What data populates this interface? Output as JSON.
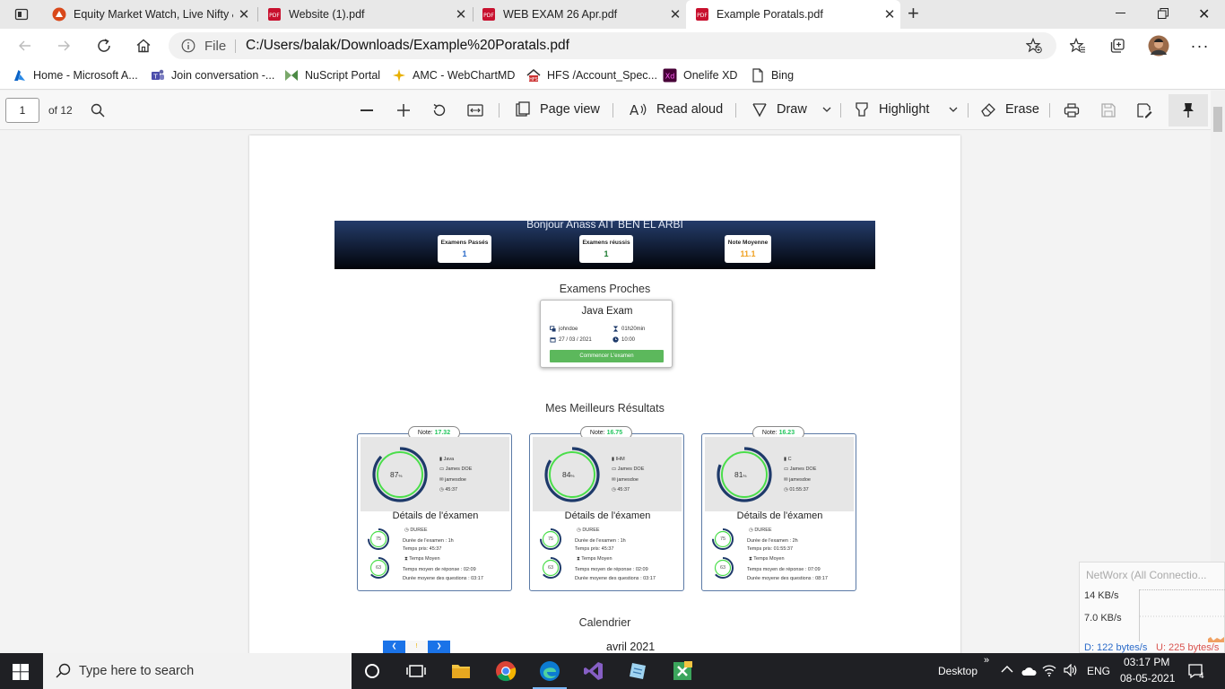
{
  "tabs": [
    {
      "title": "Equity Market Watch, Live Nifty &",
      "icon": "market-site-icon"
    },
    {
      "title": "Website (1).pdf",
      "icon": "pdf-icon"
    },
    {
      "title": "WEB EXAM 26 Apr.pdf",
      "icon": "pdf-icon"
    },
    {
      "title": "Example Poratals.pdf",
      "icon": "pdf-icon"
    }
  ],
  "address": {
    "scheme": "File",
    "url": "C:/Users/balak/Downloads/Example%20Poratals.pdf"
  },
  "bookmarks": [
    {
      "label": "Home - Microsoft A...",
      "icon": "azure-icon"
    },
    {
      "label": "Join conversation -...",
      "icon": "teams-icon"
    },
    {
      "label": "NuScript Portal",
      "icon": "nuscript-icon"
    },
    {
      "label": "AMC - WebChartMD",
      "icon": "star-burst-icon"
    },
    {
      "label": "HFS /Account_Spec...",
      "icon": "hfs-icon"
    },
    {
      "label": "Onelife XD",
      "icon": "adobe-xd-icon"
    },
    {
      "label": "Bing",
      "icon": "page-icon"
    }
  ],
  "pdf_toolbar": {
    "page": "1",
    "of": "of 12",
    "page_view": "Page view",
    "read_aloud": "Read aloud",
    "draw": "Draw",
    "highlight": "Highlight",
    "erase": "Erase"
  },
  "doc": {
    "greeting": "Bonjour Anass AIT BEN EL ARBI",
    "stats": [
      {
        "label": "Examens Passés",
        "value": "1",
        "color": "#2a6ac9"
      },
      {
        "label": "Examens réussis",
        "value": "1",
        "color": "#1a7a2e"
      },
      {
        "label": "Note Moyenne",
        "value": "11.1",
        "color": "#f0a020"
      }
    ],
    "upcoming_title": "Examens Proches",
    "exam": {
      "title": "Java Exam",
      "user": "johndoe",
      "duration": "01h20min",
      "date": "27 / 03 / 2021",
      "time": "10:00",
      "button": "Commencer L'examen"
    },
    "best_title": "Mes Meilleurs Résultats",
    "results": [
      {
        "note_label": "Note:",
        "note": "17.32",
        "percent": 87,
        "percent_text": "87",
        "subject": "Java",
        "teacher": "James DOE",
        "user": "jamesdoe",
        "time": "45:37",
        "details_title": "Détails de l'éxamen",
        "duree_label": "DUREE",
        "duree_score": "75",
        "duree_exam": "Durée de l'examen : 1h",
        "temps_pris": "Temps pris: 45:37",
        "moyen_label": "Temps Moyen",
        "moyen_score": "63",
        "moyen_rep": "Temps moyen de réponse : 02:09",
        "moyen_q": "Durée moyene des questions : 03:17"
      },
      {
        "note_label": "Note:",
        "note": "16.75",
        "percent": 84,
        "percent_text": "84",
        "subject": "IHM",
        "teacher": "James DOE",
        "user": "jamesdoe",
        "time": "45:37",
        "details_title": "Détails de l'éxamen",
        "duree_label": "DUREE",
        "duree_score": "75",
        "duree_exam": "Durée de l'examen : 1h",
        "temps_pris": "Temps pris: 45:37",
        "moyen_label": "Temps Moyen",
        "moyen_score": "63",
        "moyen_rep": "Temps moyen de réponse : 02:09",
        "moyen_q": "Durée moyene des questions : 03:17"
      },
      {
        "note_label": "Note:",
        "note": "16.23",
        "percent": 81,
        "percent_text": "81",
        "subject": "C",
        "teacher": "James DOE",
        "user": "jamesdoe",
        "time": "01:55:37",
        "details_title": "Détails de l'éxamen",
        "duree_label": "DUREE",
        "duree_score": "75",
        "duree_exam": "Durée de l'examen : 2h",
        "temps_pris": "Temps pris: 01:55:37",
        "moyen_label": "Temps Moyen",
        "moyen_score": "63",
        "moyen_rep": "Temps moyen de réponse : 07:09",
        "moyen_q": "Durée moyene des questions : 08:17"
      }
    ],
    "calendar_title": "Calendrier",
    "calendar_month": "avril 2021"
  },
  "networx": {
    "title": "NetWorx (All Connectio...",
    "rate1": "14 KB/s",
    "rate2": "7.0 KB/s",
    "down": "D: 122 bytes/s",
    "up": "U: 225 bytes/s"
  },
  "taskbar": {
    "search_placeholder": "Type here to search",
    "desktop": "Desktop",
    "lang": "ENG",
    "time": "03:17 PM",
    "date": "08-05-2021",
    "notifications": "4"
  }
}
